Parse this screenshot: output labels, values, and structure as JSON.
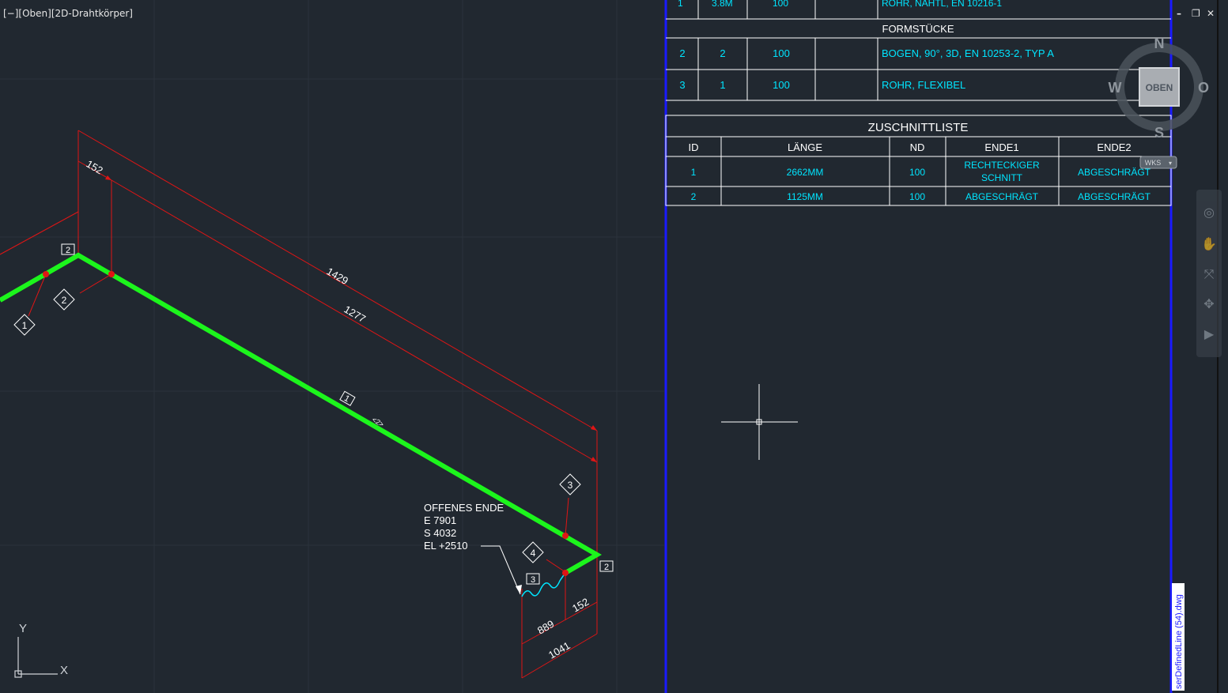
{
  "viewport": {
    "label": "[−][Oben][2D-Drahtkörper]",
    "controls": {
      "minimize": "–",
      "restore": "❐",
      "close": "✕"
    }
  },
  "viewcube": {
    "north": "N",
    "south": "S",
    "west": "W",
    "east": "O",
    "face": "OBEN",
    "wcs": "WKS"
  },
  "ucs": {
    "x": "X",
    "y": "Y"
  },
  "layout_tab": "serDefinedLine (54).dwg",
  "bom_table": {
    "partial_row": {
      "pt": "1",
      "qty": "3.8M",
      "nd": "100",
      "desc": "ROHR, NAHTL, EN 10216-1"
    },
    "section_header": "FORMSTÜCKE",
    "rows": [
      {
        "pt": "2",
        "qty": "2",
        "nd": "100",
        "desc": "BOGEN, 90°, 3D, EN 10253-2, TYP A"
      },
      {
        "pt": "3",
        "qty": "1",
        "nd": "100",
        "desc": "ROHR, FLEXIBEL"
      }
    ]
  },
  "cut_table": {
    "title": "ZUSCHNITTLISTE",
    "headers": [
      "ID",
      "LÄNGE",
      "ND",
      "ENDE1",
      "ENDE2"
    ],
    "rows": [
      {
        "id": "1",
        "length": "2662MM",
        "nd": "100",
        "end1_line1": "RECHTECKIGER",
        "end1_line2": "SCHNITT",
        "end2": "ABGESCHRÄGT"
      },
      {
        "id": "2",
        "length": "1125MM",
        "nd": "100",
        "end1": "ABGESCHRÄGT",
        "end2": "ABGESCHRÄGT"
      }
    ]
  },
  "drawing": {
    "dims": {
      "d152_top": "152",
      "d1429": "1429",
      "d1277": "1277",
      "d889": "889",
      "d152_bottom": "152",
      "d1041": "1041"
    },
    "balloons": {
      "b1": "1",
      "b2": "2",
      "b3": "3",
      "b4": "4"
    },
    "part_tags": {
      "tag_elbow_top": "2",
      "tag_elbow_bottom": "2",
      "tag_flex": "3",
      "tag_pipe": "1"
    },
    "weld_label": "<2>",
    "open_end": {
      "line1": "OFFENES ENDE",
      "line2": "E 7901",
      "line3": "S 4032",
      "line4": "EL +2510"
    }
  },
  "colors": {
    "background": "#212830",
    "pipe": "#1cf51c",
    "dimension": "#e01515",
    "table_text": "#00e5ff",
    "table_lines": "#ffffff",
    "layout_border": "#1a1aff"
  }
}
